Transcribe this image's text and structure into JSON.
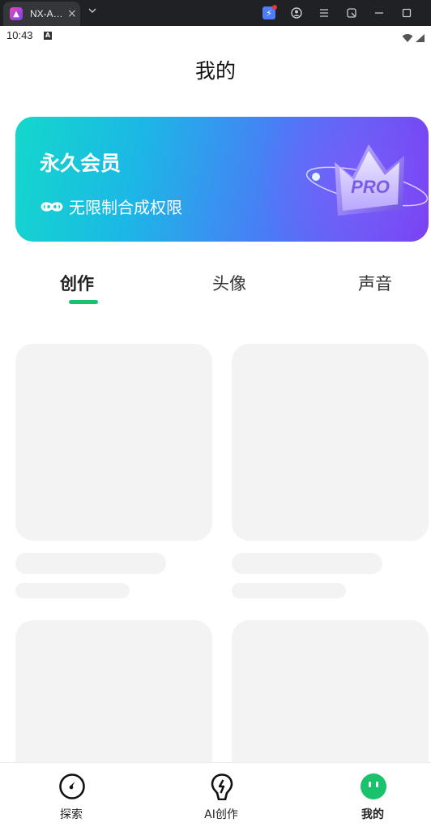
{
  "browser": {
    "tab_title": "NX-A…",
    "tab_close": "×",
    "tab_dropdown": "⌄",
    "favicon_icon": "app-logo-icon",
    "toolbar_icons": [
      "extension-icon",
      "account-icon",
      "menu-icon",
      "screenshot-icon",
      "minimize-icon",
      "maximize-icon"
    ]
  },
  "status_bar": {
    "time": "10:43",
    "notification_badge": "A"
  },
  "header": {
    "title": "我的"
  },
  "vip_banner": {
    "title": "永久会员",
    "subtitle": "无限制合成权限",
    "badge_text": "PRO",
    "colors": {
      "start": "#13d8cc",
      "mid": "#4a7cf6",
      "end": "#7b3ff2"
    }
  },
  "tabs": {
    "items": [
      {
        "label": "创作",
        "active": true
      },
      {
        "label": "头像",
        "active": false
      },
      {
        "label": "声音",
        "active": false
      }
    ],
    "indicator_color": "#19c26b"
  },
  "bottom_nav": {
    "items": [
      {
        "label": "探索",
        "icon": "compass-icon",
        "active": false
      },
      {
        "label": "AI创作",
        "icon": "lightbulb-icon",
        "active": false
      },
      {
        "label": "我的",
        "icon": "profile-face-icon",
        "active": true
      }
    ],
    "active_color": "#19c26b"
  }
}
